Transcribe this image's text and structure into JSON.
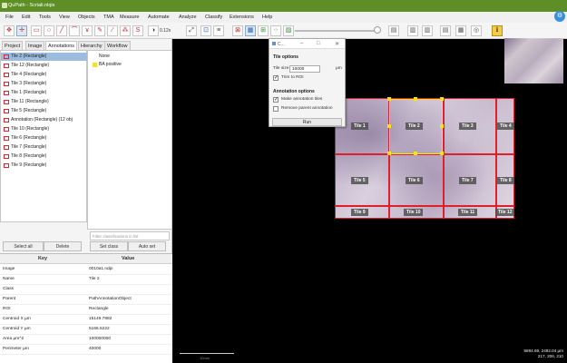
{
  "window": {
    "title": "QuPath - Scriali.nlqis"
  },
  "menu": [
    "File",
    "Edit",
    "Tools",
    "View",
    "Objects",
    "TMA",
    "Measure",
    "Automate",
    "Analyze",
    "Classify",
    "Extensions",
    "Help"
  ],
  "toolbar": {
    "zoom": "0.12x"
  },
  "left_panel": {
    "tabs": [
      "Project",
      "Image",
      "Annotations",
      "Hierarchy",
      "Workflow"
    ],
    "active_tab": "Annotations",
    "annotations": [
      "Tile 2 (Rectangle)",
      "Tile 12 (Rectangle)",
      "Tile 4 (Rectangle)",
      "Tile 3 (Rectangle)",
      "Tile 1 (Rectangle)",
      "Tile 11 (Rectangle)",
      "Tile 5 (Rectangle)",
      "Annotation (Rectangle) (12 obj",
      "Tile 10 (Rectangle)",
      "Tile 6 (Rectangle)",
      "Tile 7 (Rectangle)",
      "Tile 8 (Rectangle)",
      "Tile 9 (Rectangle)"
    ],
    "classes": [
      "None",
      "BA positive"
    ],
    "filter_placeholder": "Filter classifications in list",
    "buttons": {
      "select_all": "Select all",
      "delete": "Delete",
      "set_class": "Set class",
      "auto_set": "Auto set"
    },
    "properties": {
      "header_key": "Key",
      "header_value": "Value",
      "rows": [
        {
          "k": "Image",
          "v": "0010a1.ndpi"
        },
        {
          "k": "Name",
          "v": "Tile 2"
        },
        {
          "k": "Class",
          "v": ""
        },
        {
          "k": "Parent",
          "v": "PathAnnotationObject"
        },
        {
          "k": "ROI",
          "v": "Rectangle"
        },
        {
          "k": "Centroid X µm",
          "v": "15149.7882"
        },
        {
          "k": "Centroid Y µm",
          "v": "5166.5222"
        },
        {
          "k": "Area µm^2",
          "v": "100000000"
        },
        {
          "k": "Perimeter µm",
          "v": "40000"
        }
      ]
    }
  },
  "dialog": {
    "title": "C...",
    "section1": "Tile options",
    "tile_size_label": "Tile size",
    "tile_size_value": "10000",
    "tile_size_unit": "µm",
    "trim_label": "Trim to ROI",
    "section2": "Annotation options",
    "make_label": "Make annotation tiles",
    "remove_label": "Remove parent annotation",
    "run": "Run"
  },
  "tiles": [
    "Tile 1",
    "Tile 2",
    "Tile 3",
    "Tile 4",
    "Tile 5",
    "Tile 6",
    "Tile 7",
    "Tile 8",
    "Tile 9",
    "Tile 10",
    "Tile 11",
    "Tile 12"
  ],
  "status": {
    "coords_line1": "5894.69, 2492.04 µm",
    "coords_line2": "217, 206, 210",
    "scale_label": "10mm"
  }
}
